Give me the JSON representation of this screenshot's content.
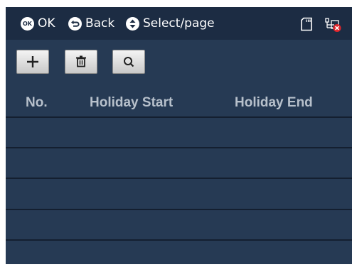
{
  "statusbar": {
    "hints": [
      {
        "icon": "ok-button-icon",
        "label": "OK",
        "glyph": "OK"
      },
      {
        "icon": "back-arrow-icon",
        "label": "Back"
      },
      {
        "icon": "up-down-select-icon",
        "label": "Select/page"
      }
    ],
    "right_icons": [
      "sd-card-icon",
      "network-disconnected-icon"
    ]
  },
  "toolbar": {
    "buttons": [
      {
        "icon": "add-icon",
        "name": "add-button"
      },
      {
        "icon": "delete-icon",
        "name": "delete-button"
      },
      {
        "icon": "search-icon",
        "name": "search-button"
      }
    ]
  },
  "table": {
    "columns": [
      "No.",
      "Holiday Start",
      "Holiday End"
    ],
    "rows": 5
  },
  "colors": {
    "background": "#263a54",
    "statusbar": "#1c2c43",
    "header_text": "#b7c0cb",
    "row_line": "#141f30",
    "alert_red": "#e0252b"
  }
}
